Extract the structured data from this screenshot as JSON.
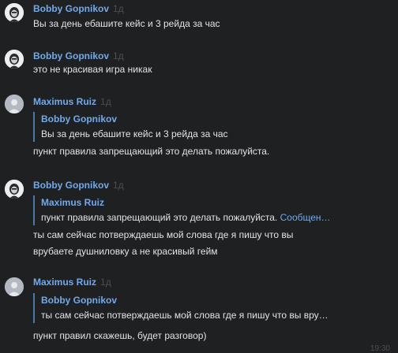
{
  "messages": [
    {
      "author": "Bobby Gopnikov",
      "time": "1д",
      "text": "Вы за день ебашите кейс и 3 рейда за час"
    },
    {
      "author": "Bobby Gopnikov",
      "time": "1д",
      "text": "это не красивая игра никак"
    },
    {
      "author": "Maximus Ruiz",
      "time": "1д",
      "quote_author": "Bobby Gopnikov",
      "quote_text": "Вы за день ебашите кейс и 3 рейда за час",
      "text": "пункт правила запрещающий это делать пожалуйста."
    },
    {
      "author": "Bobby Gopnikov",
      "time": "1д",
      "quote_author": "Maximus Ruiz",
      "quote_text": "пункт правила запрещающий это делать пожалуйста.",
      "quote_link": "Сообщен…",
      "text_line1": "ты сам сейчас потверждаешь мой слова где я пишу что вы",
      "text_line2": "врубаете душниловку а не красивый гейм"
    },
    {
      "author": "Maximus Ruiz",
      "time": "1д",
      "quote_author": "Bobby Gopnikov",
      "quote_text": "ты сам сейчас потверждаешь мой слова где я пишу что вы вру…",
      "text": "пункт правил скажешь, будет разговор)"
    }
  ],
  "footer_time": "19:30"
}
